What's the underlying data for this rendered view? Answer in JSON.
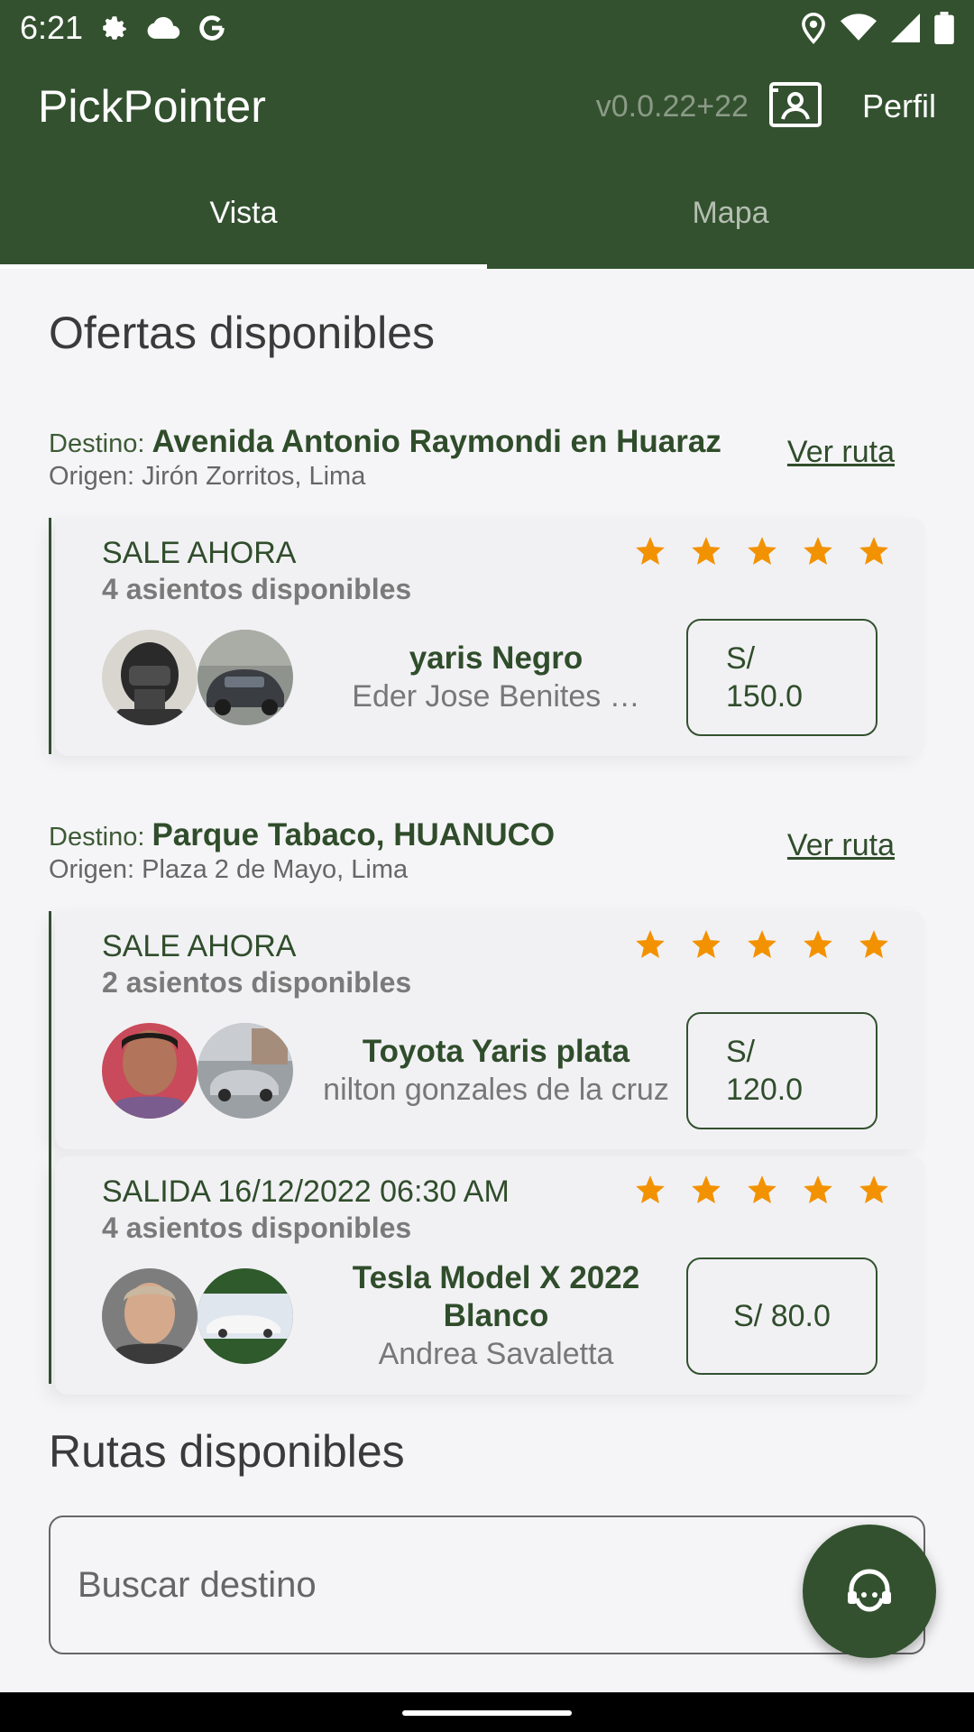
{
  "status_bar": {
    "time": "6:21",
    "icons": [
      "gear-icon",
      "cloud-icon",
      "google-icon",
      "location-icon",
      "wifi-icon",
      "signal-icon",
      "battery-icon"
    ]
  },
  "app_bar": {
    "title": "PickPointer",
    "version": "v0.0.22+22",
    "profile_label": "Perfil",
    "badge_icon": "badge-icon"
  },
  "tabs": [
    {
      "label": "Vista",
      "active": true
    },
    {
      "label": "Mapa",
      "active": false
    }
  ],
  "offers_section": {
    "title": "Ofertas disponibles"
  },
  "routes": [
    {
      "destination_label": "Destino:",
      "destination": "Avenida Antonio Raymondi en Huaraz",
      "origin": "Origen: Jirón Zorritos, Lima",
      "link": "Ver ruta",
      "offers": [
        {
          "status": "SALE AHORA",
          "seats": "4 asientos disponibles",
          "rating": 5,
          "car": "yaris Negro",
          "driver": "Eder Jose Benites …",
          "price": "S/\n150.0"
        }
      ]
    },
    {
      "destination_label": "Destino:",
      "destination": "Parque Tabaco, HUANUCO",
      "origin": "Origen: Plaza 2 de Mayo, Lima",
      "link": "Ver ruta",
      "offers": [
        {
          "status": "SALE AHORA",
          "seats": "2 asientos disponibles",
          "rating": 5,
          "car": "Toyota Yaris  plata",
          "driver": "nilton gonzales de la cruz",
          "price": "S/\n120.0"
        },
        {
          "status": "SALIDA 16/12/2022 06:30 AM",
          "seats": "4 asientos disponibles",
          "rating": 5,
          "car": "Tesla Model X 2022 Blanco",
          "driver": "Andrea Savaletta",
          "price": "S/ 80.0"
        }
      ]
    }
  ],
  "routes_section": {
    "title": "Rutas disponibles"
  },
  "search": {
    "placeholder": "Buscar destino",
    "value": ""
  },
  "fab": {
    "icon": "support-agent-icon"
  },
  "colors": {
    "primary": "#33512f",
    "star": "#f39200",
    "background": "#f5f5f7"
  }
}
